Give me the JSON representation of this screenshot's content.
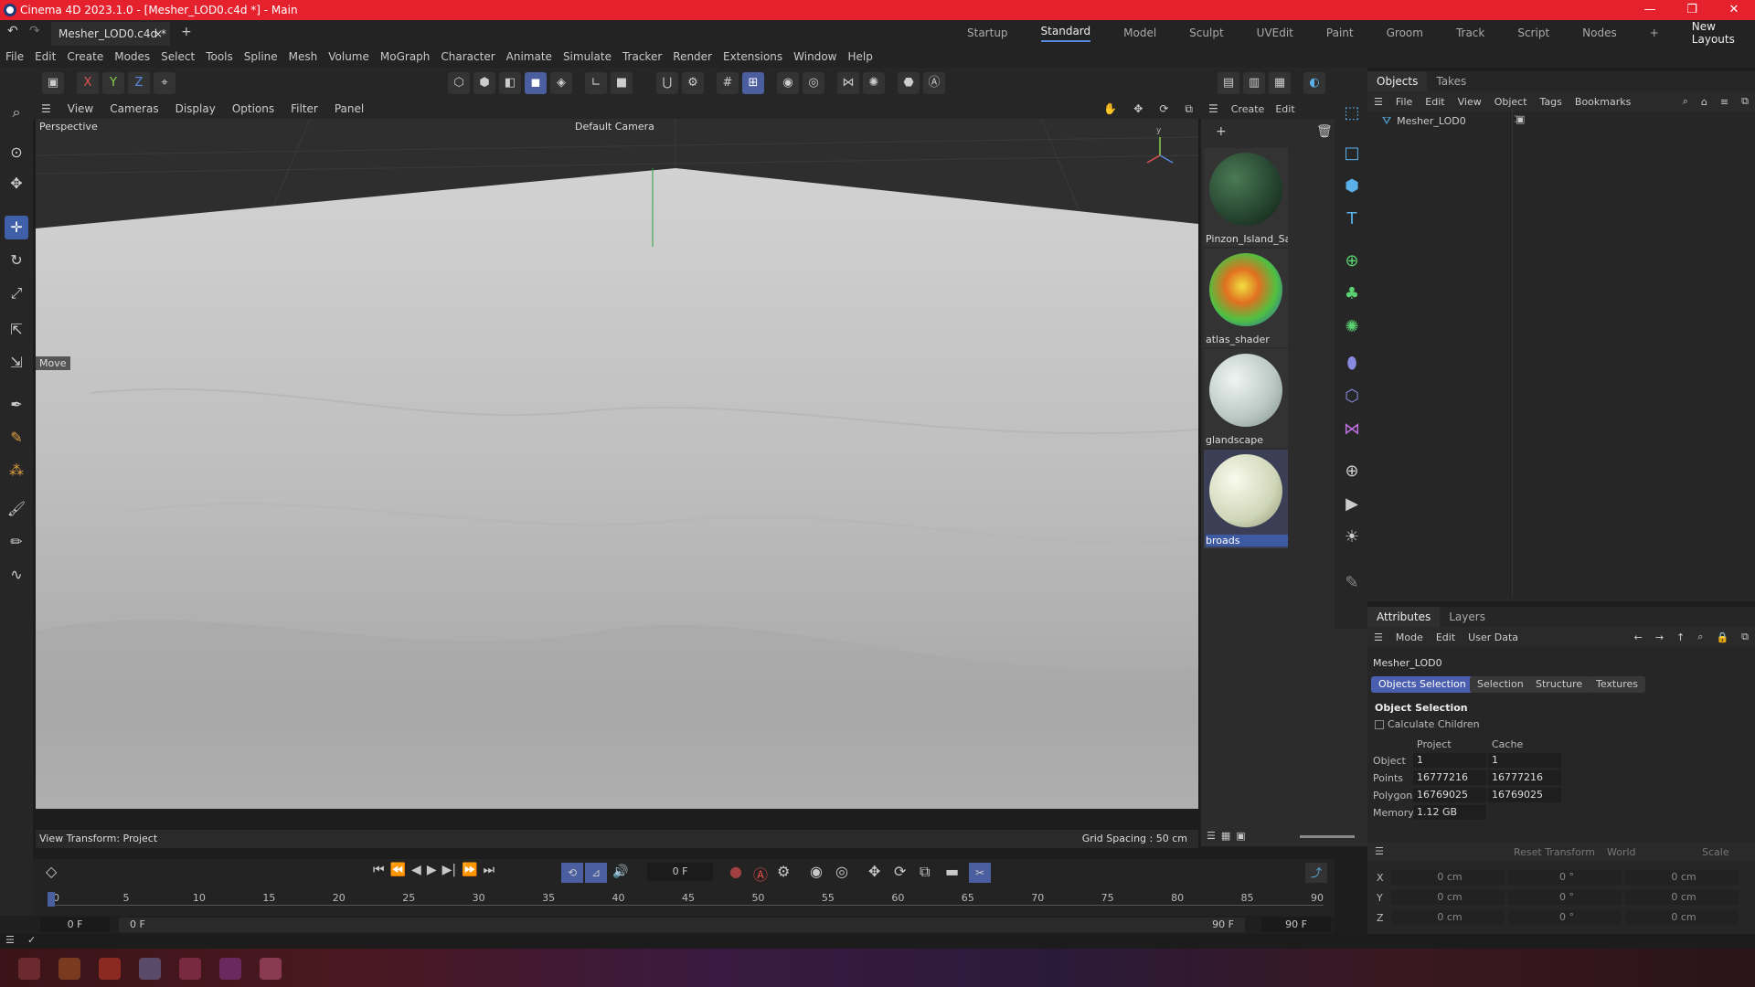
{
  "window": {
    "title": "Cinema 4D 2023.1.0 - [Mesher_LOD0.c4d *] - Main",
    "controls": [
      "—",
      "❐",
      "✕"
    ]
  },
  "doc_tab": {
    "label": "Mesher_LOD0.c4d *",
    "close": "×",
    "add": "+"
  },
  "layouts": {
    "items": [
      "Startup",
      "Standard",
      "Model",
      "Sculpt",
      "UVEdit",
      "Paint",
      "Groom",
      "Track",
      "Script",
      "Nodes"
    ],
    "active": "Standard",
    "add": "+",
    "new_layouts": "New Layouts"
  },
  "menubar": [
    "File",
    "Edit",
    "Create",
    "Modes",
    "Select",
    "Tools",
    "Spline",
    "Mesh",
    "Volume",
    "MoGraph",
    "Character",
    "Animate",
    "Simulate",
    "Tracker",
    "Render",
    "Extensions",
    "Window",
    "Help"
  ],
  "toolbar": {
    "axis_x": "X",
    "axis_y": "Y",
    "axis_z": "Z"
  },
  "viewport_menu": [
    "View",
    "Cameras",
    "Display",
    "Options",
    "Filter",
    "Panel"
  ],
  "viewport": {
    "projection": "Perspective",
    "camera": "Default Camera",
    "tool_hint": "Move",
    "view_transform": "View Transform: Project",
    "grid_spacing": "Grid Spacing : 50 cm"
  },
  "materials": {
    "menu": [
      "Create",
      "Edit"
    ],
    "items": [
      {
        "name": "Pinzon_Island_Sat",
        "color": "#2f5a3a"
      },
      {
        "name": "atlas_shader",
        "color": "#5ac83c"
      },
      {
        "name": "glandscape",
        "color": "#c9d4d0"
      },
      {
        "name": "broads",
        "color": "#d8dcc0"
      }
    ],
    "selected": "broads"
  },
  "objects_panel": {
    "tabs": [
      "Objects",
      "Takes"
    ],
    "menu": [
      "File",
      "Edit",
      "View",
      "Object",
      "Tags",
      "Bookmarks"
    ],
    "items": [
      {
        "name": "Mesher_LOD0"
      }
    ]
  },
  "attributes": {
    "tabs": [
      "Attributes",
      "Layers"
    ],
    "menu": [
      "Mode",
      "Edit",
      "User Data"
    ],
    "object_name": "Mesher_LOD0",
    "subtabs": [
      "Objects Selection",
      "Selection",
      "Structure",
      "Textures"
    ],
    "section": "Object Selection",
    "calculate_children": "Calculate Children",
    "col_project": "Project",
    "col_cache": "Cache",
    "rows": [
      {
        "label": "Object",
        "project": "1",
        "cache": "1"
      },
      {
        "label": "Points",
        "project": "16777216",
        "cache": "16777216"
      },
      {
        "label": "Polygons",
        "project": "16769025",
        "cache": "16769025"
      },
      {
        "label": "Memory",
        "project": "1.12 GB",
        "cache": ""
      }
    ]
  },
  "coordinates": {
    "reset": "Reset Transform",
    "space": "World",
    "mode": "Scale",
    "rows": [
      {
        "axis": "X",
        "pos": "0 cm",
        "rot": "0 °",
        "scale": "0 cm"
      },
      {
        "axis": "Y",
        "pos": "0 cm",
        "rot": "0 °",
        "scale": "0 cm"
      },
      {
        "axis": "Z",
        "pos": "0 cm",
        "rot": "0 °",
        "scale": "0 cm"
      }
    ]
  },
  "timeline": {
    "current_frame": "0 F",
    "ticks": [
      "0",
      "5",
      "10",
      "15",
      "20",
      "25",
      "30",
      "35",
      "40",
      "45",
      "50",
      "55",
      "60",
      "65",
      "70",
      "75",
      "80",
      "85",
      "90"
    ],
    "start": "0 F",
    "range_start": "0 F",
    "range_end": "90 F",
    "end": "90 F"
  }
}
